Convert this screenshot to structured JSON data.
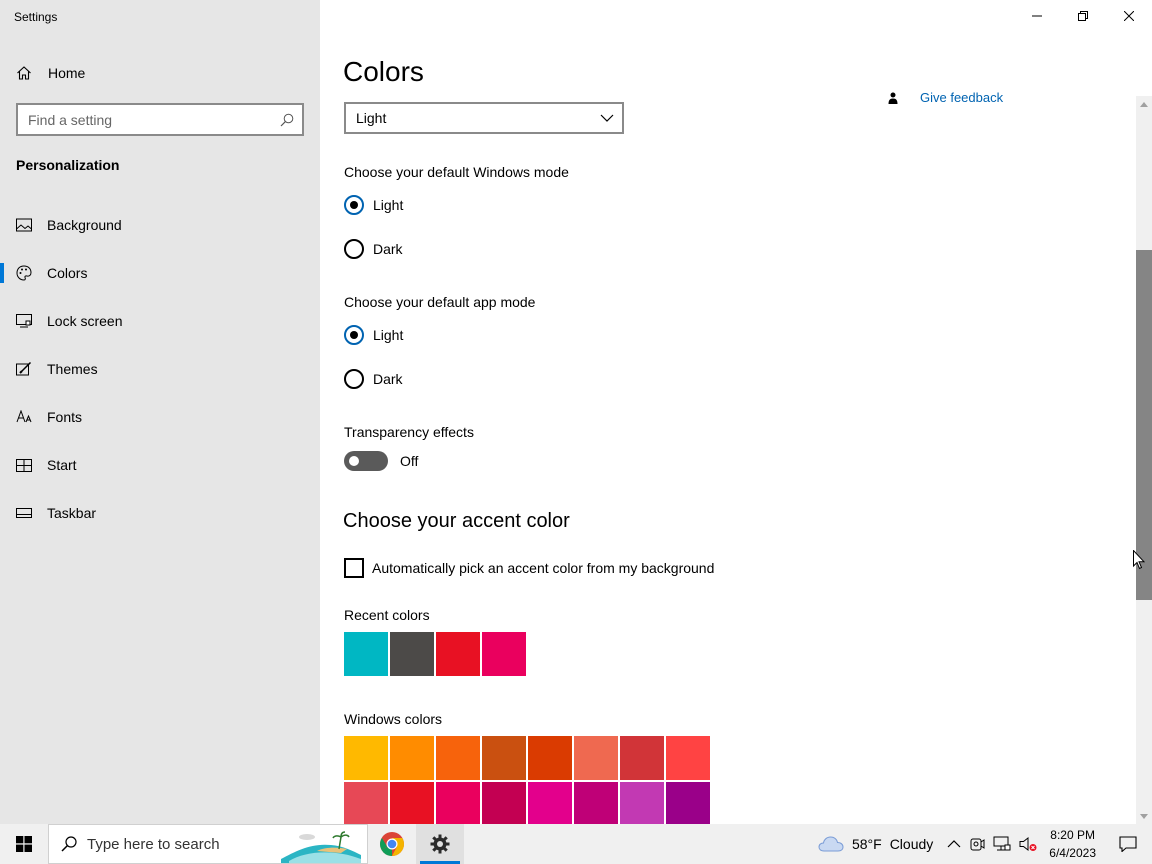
{
  "window": {
    "title": "Settings",
    "minimize_label": "Minimize",
    "maximize_label": "Restore",
    "close_label": "Close"
  },
  "sidebar": {
    "home_label": "Home",
    "search_placeholder": "Find a setting",
    "section_title": "Personalization",
    "items": [
      {
        "label": "Background",
        "icon": "image-icon"
      },
      {
        "label": "Colors",
        "icon": "palette-icon",
        "active": true
      },
      {
        "label": "Lock screen",
        "icon": "lock-screen-icon"
      },
      {
        "label": "Themes",
        "icon": "themes-brush-icon"
      },
      {
        "label": "Fonts",
        "icon": "fonts-icon"
      },
      {
        "label": "Start",
        "icon": "start-icon"
      },
      {
        "label": "Taskbar",
        "icon": "taskbar-icon"
      }
    ]
  },
  "main": {
    "title": "Colors",
    "feedback_label": "Give feedback",
    "color_dropdown_value": "Light",
    "windows_mode_label": "Choose your default Windows mode",
    "windows_mode_options": [
      "Light",
      "Dark"
    ],
    "windows_mode_selected": "Light",
    "app_mode_label": "Choose your default app mode",
    "app_mode_options": [
      "Light",
      "Dark"
    ],
    "app_mode_selected": "Light",
    "transparency_label": "Transparency effects",
    "transparency_state": "Off",
    "accent_heading": "Choose your accent color",
    "auto_accent_label": "Automatically pick an accent color from my background",
    "auto_accent_checked": false,
    "recent_colors_label": "Recent colors",
    "recent_colors": [
      "#00b7c3",
      "#4c4a48",
      "#e81123",
      "#ea005e"
    ],
    "windows_colors_label": "Windows colors",
    "windows_colors": [
      "#ffb900",
      "#ff8c00",
      "#f7630c",
      "#ca5010",
      "#da3b01",
      "#ef6950",
      "#d13438",
      "#ff4343",
      "#e74856",
      "#e81123",
      "#ea005e",
      "#c30052",
      "#e3008c",
      "#bf0077",
      "#c239b3",
      "#9a0089"
    ]
  },
  "taskbar": {
    "search_placeholder": "Type here to search",
    "weather_temp": "58°F",
    "weather_condition": "Cloudy",
    "time": "8:20 PM",
    "date": "6/4/2023",
    "accent_color": "#0078d7"
  }
}
